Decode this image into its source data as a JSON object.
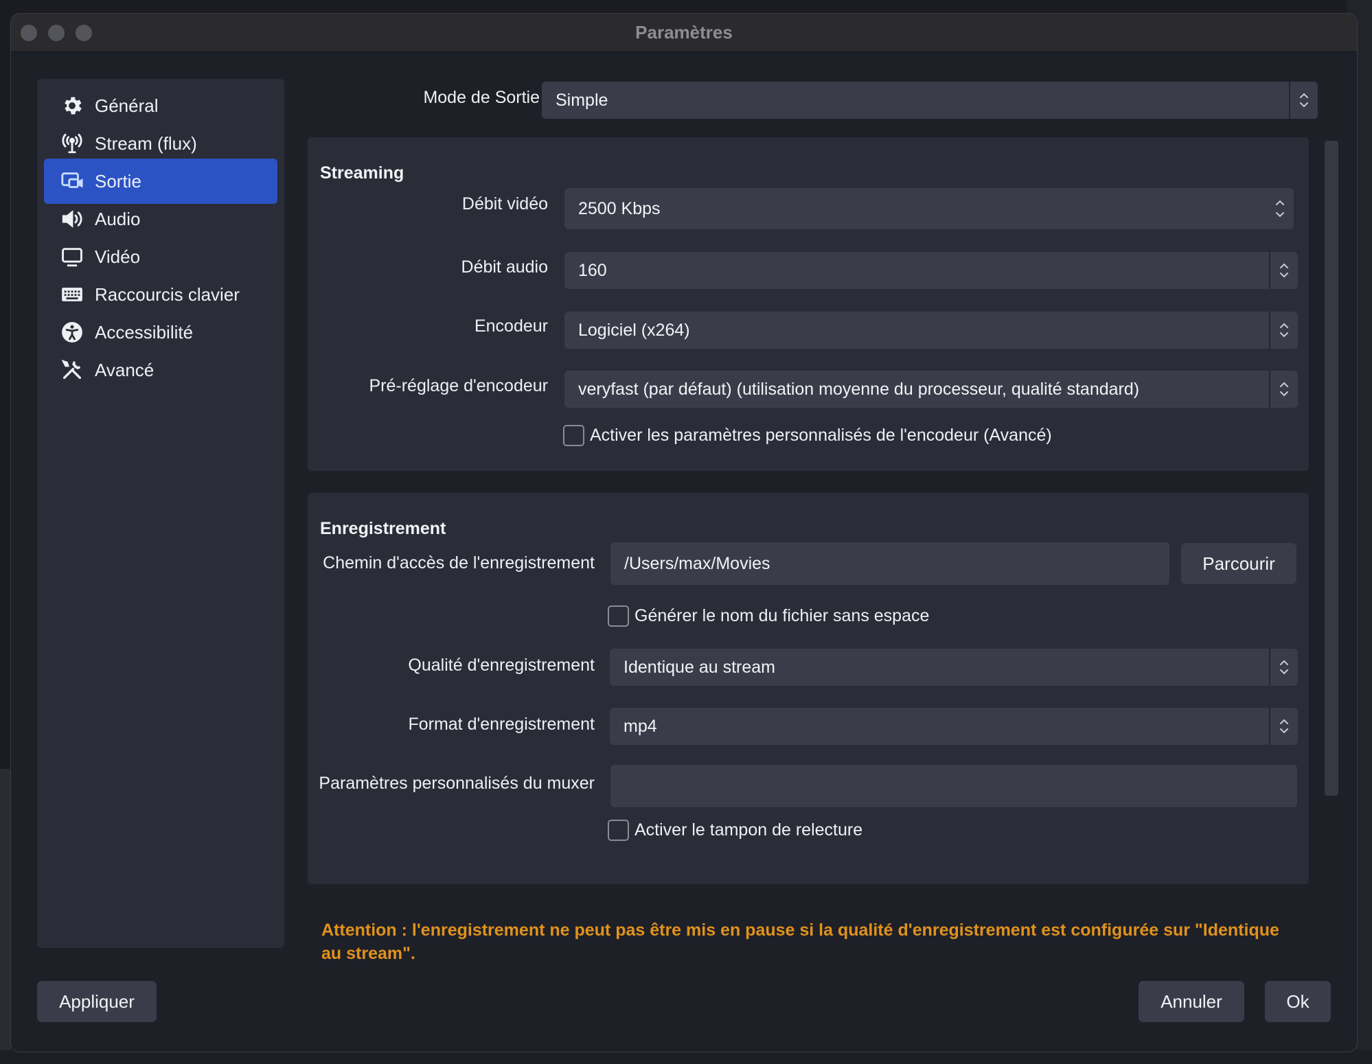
{
  "window": {
    "title": "Paramètres"
  },
  "sidebar": {
    "items": [
      {
        "label": "Général",
        "icon": "gear-icon"
      },
      {
        "label": "Stream (flux)",
        "icon": "antenna-icon"
      },
      {
        "label": "Sortie",
        "icon": "output-icon",
        "active": true
      },
      {
        "label": "Audio",
        "icon": "speaker-icon"
      },
      {
        "label": "Vidéo",
        "icon": "monitor-icon"
      },
      {
        "label": "Raccourcis clavier",
        "icon": "keyboard-icon"
      },
      {
        "label": "Accessibilité",
        "icon": "accessibility-icon"
      },
      {
        "label": "Avancé",
        "icon": "tools-icon"
      }
    ]
  },
  "output_mode": {
    "label": "Mode de Sortie",
    "value": "Simple"
  },
  "streaming": {
    "title": "Streaming",
    "video_bitrate": {
      "label": "Débit vidéo",
      "value": "2500 Kbps"
    },
    "audio_bitrate": {
      "label": "Débit audio",
      "value": "160"
    },
    "encoder": {
      "label": "Encodeur",
      "value": "Logiciel (x264)"
    },
    "preset": {
      "label": "Pré-réglage d'encodeur",
      "value": "veryfast (par défaut) (utilisation moyenne du processeur, qualité standard)"
    },
    "custom_settings": {
      "label": "Activer les paramètres personnalisés de l'encodeur (Avancé)",
      "checked": false
    }
  },
  "recording": {
    "title": "Enregistrement",
    "path": {
      "label": "Chemin d'accès de l'enregistrement",
      "value": "/Users/max/Movies"
    },
    "browse_label": "Parcourir",
    "no_space": {
      "label": "Générer le nom du fichier sans espace",
      "checked": false
    },
    "quality": {
      "label": "Qualité d'enregistrement",
      "value": "Identique au stream"
    },
    "format": {
      "label": "Format d'enregistrement",
      "value": "mp4"
    },
    "muxer": {
      "label": "Paramètres personnalisés du muxer",
      "value": ""
    },
    "replay_buffer": {
      "label": "Activer le tampon de relecture",
      "checked": false
    }
  },
  "warning": "Attention : l'enregistrement ne peut pas être mis en pause si la qualité d'enregistrement est configurée sur \"Identique au stream\".",
  "footer": {
    "apply_label": "Appliquer",
    "cancel_label": "Annuler",
    "ok_label": "Ok"
  },
  "colors": {
    "accent": "#2b53c4",
    "warning": "#e0921c",
    "panel": "#2a2d38",
    "field": "#3a3d49"
  }
}
